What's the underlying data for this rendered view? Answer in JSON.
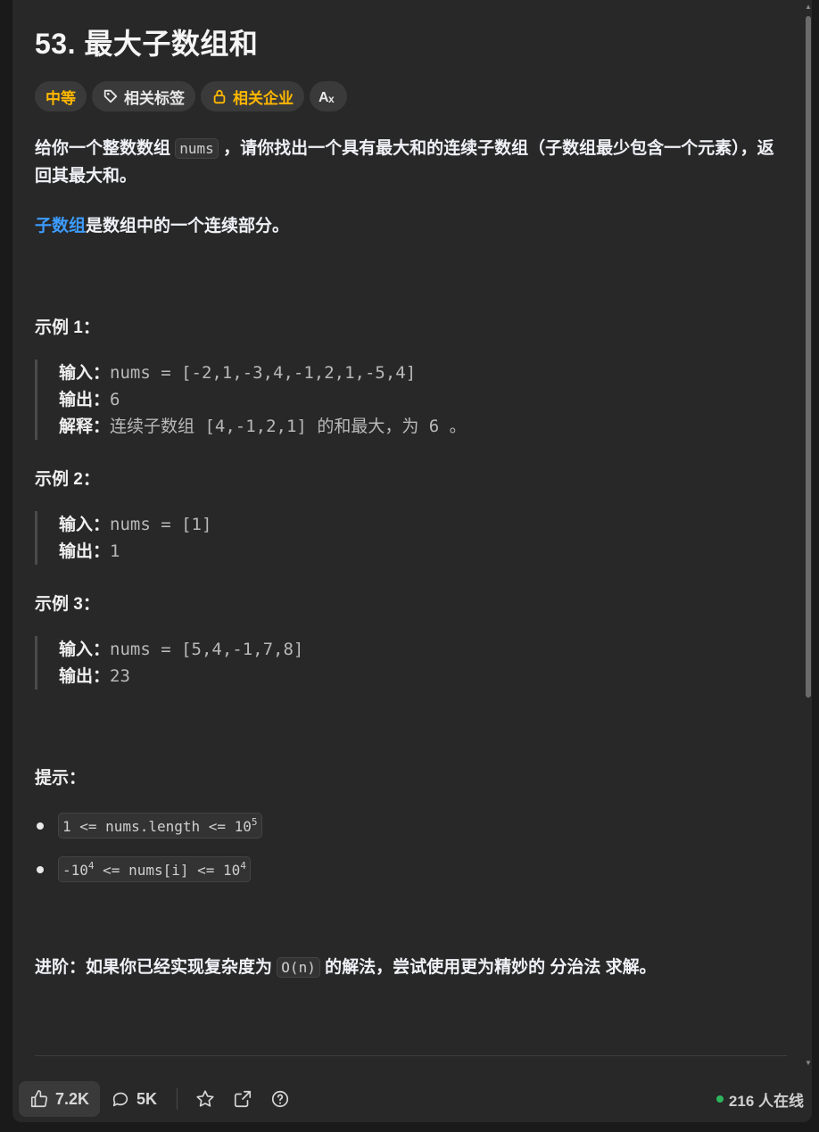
{
  "problem": {
    "title": "53. 最大子数组和",
    "tags": {
      "difficulty": "中等",
      "related_tags": "相关标签",
      "related_companies": "相关企业",
      "translate_icon": "translate-icon"
    },
    "description": {
      "part1": "给你一个整数数组 ",
      "code": "nums",
      "part2": " ，请你找出一个具有最大和的连续子数组（子数组最少包含一个元素），返回其最大和。",
      "subarray_link": "子数组",
      "subarray_rest": "是数组中的一个连续部分。"
    },
    "examples": [
      {
        "heading": "示例 1：",
        "input_label": "输入：",
        "input": "nums = [-2,1,-3,4,-1,2,1,-5,4]",
        "output_label": "输出：",
        "output": "6",
        "explain_label": "解释：",
        "explain_a": "连续子数组",
        "explain_code": " [4,-1,2,1] ",
        "explain_b": "的和最大，为",
        "explain_num": " 6 ",
        "explain_c": "。"
      },
      {
        "heading": "示例 2：",
        "input_label": "输入：",
        "input": "nums = [1]",
        "output_label": "输出：",
        "output": "1"
      },
      {
        "heading": "示例 3：",
        "input_label": "输入：",
        "input": "nums = [5,4,-1,7,8]",
        "output_label": "输出：",
        "output": "23"
      }
    ],
    "hints_heading": "提示：",
    "constraints": [
      {
        "pre": "1 <= nums.length <= 10",
        "sup": "5",
        "post": ""
      },
      {
        "pre": "-10",
        "sup": "4",
        "mid": " <= nums[i] <= 10",
        "sup2": "4"
      }
    ],
    "follow_up": {
      "label": "进阶：",
      "text1": "如果你已经实现复杂度为 ",
      "code": "O(n)",
      "text2": " 的解法，尝试使用更为精妙的 ",
      "bold": "分治法",
      "text3": " 求解。"
    }
  },
  "footer": {
    "likes": "7.2K",
    "comments": "5K",
    "online": "216 人在线"
  },
  "colors": {
    "difficulty": "#ffb800",
    "link": "#3c9cff",
    "online_dot": "#2db55d"
  }
}
